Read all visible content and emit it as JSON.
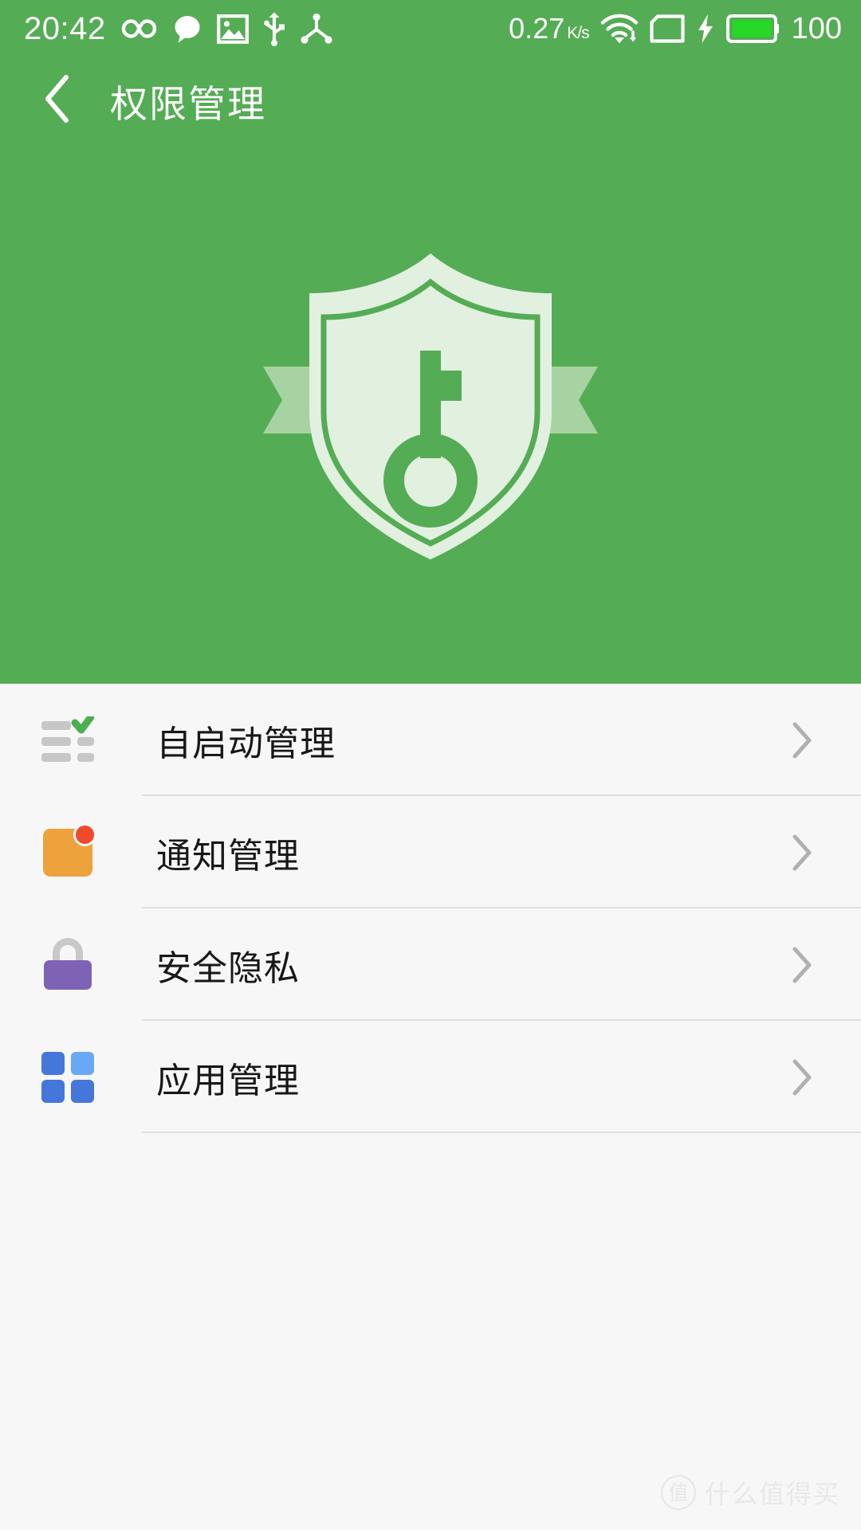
{
  "statusbar": {
    "time": "20:42",
    "network_speed": "0.27",
    "network_speed_unit": "K/s",
    "battery_level": "100",
    "left_icons": [
      {
        "name": "infinity-icon",
        "glyph": "infinity"
      },
      {
        "name": "chat-bubble-icon",
        "glyph": "chat"
      },
      {
        "name": "gallery-image-icon",
        "glyph": "image"
      },
      {
        "name": "usb-icon",
        "glyph": "usb"
      },
      {
        "name": "share-node-icon",
        "glyph": "share"
      }
    ],
    "right_icons": [
      {
        "name": "wifi-download-icon",
        "glyph": "wifi"
      },
      {
        "name": "sim-card-icon",
        "glyph": "sim"
      },
      {
        "name": "charging-bolt-icon",
        "glyph": "bolt"
      },
      {
        "name": "battery-icon",
        "glyph": "battery"
      }
    ]
  },
  "header": {
    "title": "权限管理",
    "back_icon": "chevron-left-icon"
  },
  "hero": {
    "illustration": "shield-key-badge",
    "background_color": "#54ac54",
    "shield_fill": "#e2f0e0",
    "shield_accent": "#54ac54",
    "ribbon_fill": "#a7d3a2"
  },
  "list": {
    "background_color": "#f7f7f7",
    "items": [
      {
        "label": "自启动管理",
        "icon": "checklist-check-icon",
        "icon_colors": {
          "bar": "#c7c7c7",
          "check": "#4caf50"
        },
        "chevron": "chevron-right-icon"
      },
      {
        "label": "通知管理",
        "icon": "notification-badge-icon",
        "icon_colors": {
          "square": "#eea23c",
          "dot": "#f04a2a"
        },
        "chevron": "chevron-right-icon"
      },
      {
        "label": "安全隐私",
        "icon": "padlock-icon",
        "icon_colors": {
          "body": "#7e62b5",
          "shackle": "#c9c9c9"
        },
        "chevron": "chevron-right-icon"
      },
      {
        "label": "应用管理",
        "icon": "apps-grid-icon",
        "icon_colors": {
          "cell": "#4577db",
          "cell_light": "#6aa8f5"
        },
        "chevron": "chevron-right-icon"
      }
    ]
  },
  "watermark": {
    "badge_char": "值",
    "text": "什么值得买"
  }
}
